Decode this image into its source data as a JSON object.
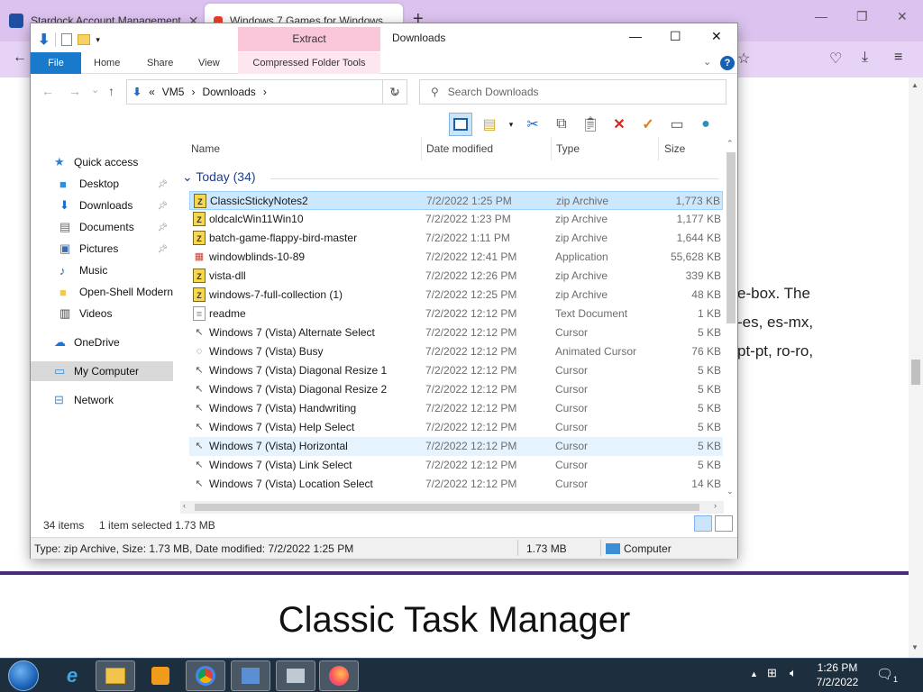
{
  "browser": {
    "tabs": [
      {
        "label": "Stardock Account Management",
        "active": false
      },
      {
        "label": "Windows 7 Games for Windows",
        "active": true
      }
    ],
    "new_tab": "+",
    "win_min": "—",
    "win_restore": "❐",
    "win_close": "✕"
  },
  "page": {
    "side_lines": [
      "e-box. The",
      "-es, es-mx,",
      "pt-pt, ro-ro,"
    ],
    "heading": "Classic Task Manager"
  },
  "explorer": {
    "title": "Downloads",
    "context_tab": "Extract",
    "ribbon_tabs": [
      "File",
      "Home",
      "Share",
      "View",
      "Compressed Folder Tools"
    ],
    "help": "?",
    "address": {
      "root": "VM5",
      "folder": "Downloads",
      "sep": "›",
      "prefix": "«"
    },
    "search_placeholder": "Search Downloads",
    "nav": [
      {
        "label": "Quick access",
        "pinned": false
      },
      {
        "label": "Desktop",
        "pinned": true
      },
      {
        "label": "Downloads",
        "pinned": true
      },
      {
        "label": "Documents",
        "pinned": true
      },
      {
        "label": "Pictures",
        "pinned": true
      },
      {
        "label": "Music",
        "pinned": false
      },
      {
        "label": "Open-Shell Modern",
        "pinned": false
      },
      {
        "label": "Videos",
        "pinned": false
      },
      {
        "label": "OneDrive",
        "pinned": false
      },
      {
        "label": "My Computer",
        "pinned": false
      },
      {
        "label": "Network",
        "pinned": false
      }
    ],
    "columns": [
      "Name",
      "Date modified",
      "Type",
      "Size"
    ],
    "group": "Today (34)",
    "files": [
      {
        "name": "ClassicStickyNotes2",
        "date": "7/2/2022 1:25 PM",
        "type": "zip Archive",
        "size": "1,773 KB",
        "icon": "zip-icon"
      },
      {
        "name": "oldcalcWin11Win10",
        "date": "7/2/2022 1:23 PM",
        "type": "zip Archive",
        "size": "1,177 KB",
        "icon": "zip-icon"
      },
      {
        "name": "batch-game-flappy-bird-master",
        "date": "7/2/2022 1:11 PM",
        "type": "zip Archive",
        "size": "1,644 KB",
        "icon": "zip-icon"
      },
      {
        "name": "windowblinds-10-89",
        "date": "7/2/2022 12:41 PM",
        "type": "Application",
        "size": "55,628 KB",
        "icon": "app-icon"
      },
      {
        "name": "vista-dll",
        "date": "7/2/2022 12:26 PM",
        "type": "zip Archive",
        "size": "339 KB",
        "icon": "zip-icon"
      },
      {
        "name": "windows-7-full-collection (1)",
        "date": "7/2/2022 12:25 PM",
        "type": "zip Archive",
        "size": "48 KB",
        "icon": "zip-icon"
      },
      {
        "name": "readme",
        "date": "7/2/2022 12:12 PM",
        "type": "Text Document",
        "size": "1 KB",
        "icon": "text-icon"
      },
      {
        "name": "Windows 7 (Vista) Alternate Select",
        "date": "7/2/2022 12:12 PM",
        "type": "Cursor",
        "size": "5 KB",
        "icon": "cursor-icon"
      },
      {
        "name": "Windows 7 (Vista) Busy",
        "date": "7/2/2022 12:12 PM",
        "type": "Animated Cursor",
        "size": "76 KB",
        "icon": "busy-icon"
      },
      {
        "name": "Windows 7 (Vista) Diagonal Resize 1",
        "date": "7/2/2022 12:12 PM",
        "type": "Cursor",
        "size": "5 KB",
        "icon": "cursor-icon"
      },
      {
        "name": "Windows 7 (Vista) Diagonal Resize 2",
        "date": "7/2/2022 12:12 PM",
        "type": "Cursor",
        "size": "5 KB",
        "icon": "cursor-icon"
      },
      {
        "name": "Windows 7 (Vista) Handwriting",
        "date": "7/2/2022 12:12 PM",
        "type": "Cursor",
        "size": "5 KB",
        "icon": "cursor-icon"
      },
      {
        "name": "Windows 7 (Vista) Help Select",
        "date": "7/2/2022 12:12 PM",
        "type": "Cursor",
        "size": "5 KB",
        "icon": "cursor-icon"
      },
      {
        "name": "Windows 7 (Vista) Horizontal",
        "date": "7/2/2022 12:12 PM",
        "type": "Cursor",
        "size": "5 KB",
        "icon": "cursor-icon"
      },
      {
        "name": "Windows 7 (Vista) Link Select",
        "date": "7/2/2022 12:12 PM",
        "type": "Cursor",
        "size": "5 KB",
        "icon": "cursor-icon"
      },
      {
        "name": "Windows 7 (Vista) Location Select",
        "date": "7/2/2022 12:12 PM",
        "type": "Cursor",
        "size": "14 KB",
        "icon": "cursor-icon"
      }
    ],
    "status_count": "34 items",
    "status_selection": "1 item selected  1.73 MB",
    "details": "Type: zip Archive, Size: 1.73 MB, Date modified: 7/2/2022 1:25 PM",
    "details_size": "1.73 MB",
    "details_location": "Computer"
  },
  "taskbar": {
    "time": "1:26 PM",
    "date": "7/2/2022",
    "tray_arrow": "▲",
    "notif_count": "1"
  }
}
